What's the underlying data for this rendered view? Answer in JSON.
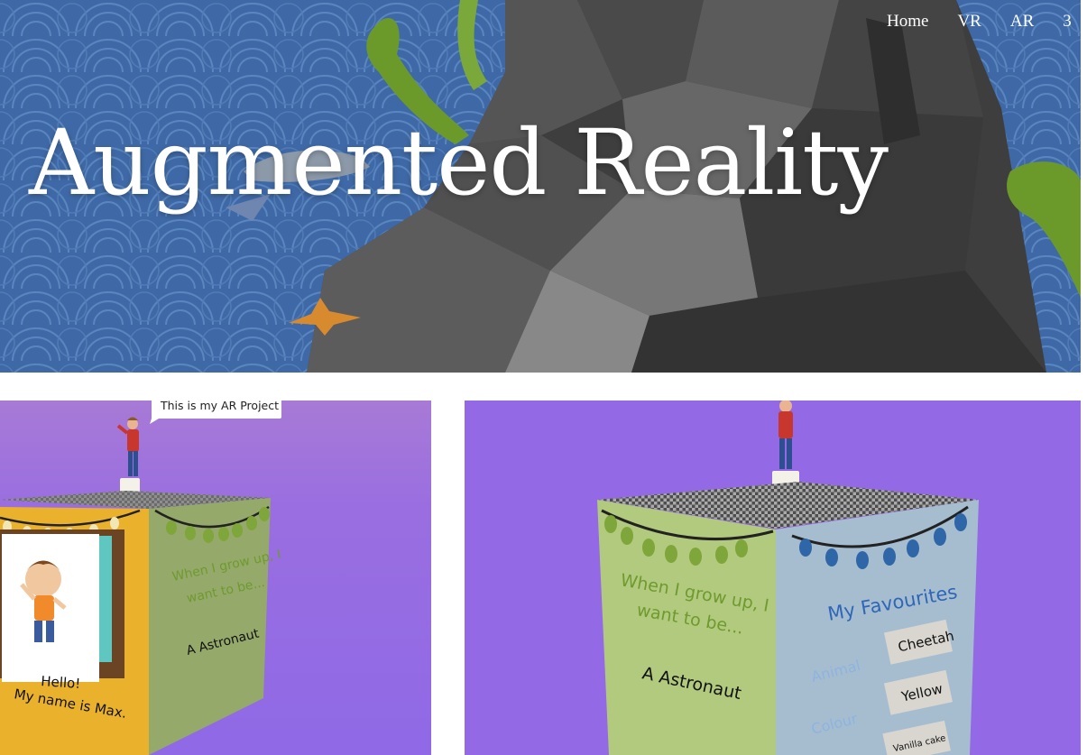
{
  "nav": {
    "items": [
      "Home",
      "VR",
      "AR",
      "3"
    ]
  },
  "hero": {
    "title": "Augmented Reality"
  },
  "left_card": {
    "speech_bubble": "This is  my AR Project",
    "face_front_hello": "Hello!",
    "face_front_name": "My name is Max.",
    "face_side_line1": "When I grow up, I",
    "face_side_line2": "want to be...",
    "face_side_answer": "A Astronaut"
  },
  "right_card": {
    "face_left_line1": "When I grow up, I",
    "face_left_line2": "want to be...",
    "face_left_answer": "A Astronaut",
    "favourites_title": "My Favourites",
    "rows": [
      {
        "label": "Animal",
        "value": "Cheetah"
      },
      {
        "label": "Colour",
        "value": "Yellow"
      },
      {
        "label": "",
        "value": "Vanilla cake"
      }
    ]
  },
  "colors": {
    "hero_sea": "#3f69a6",
    "card_purple": "#9369e6",
    "cube_yellow": "#e9b12c",
    "cube_green": "#95a96a",
    "cube_light_green": "#b2ca7e",
    "cube_blue_grey": "#a6bdd0"
  }
}
